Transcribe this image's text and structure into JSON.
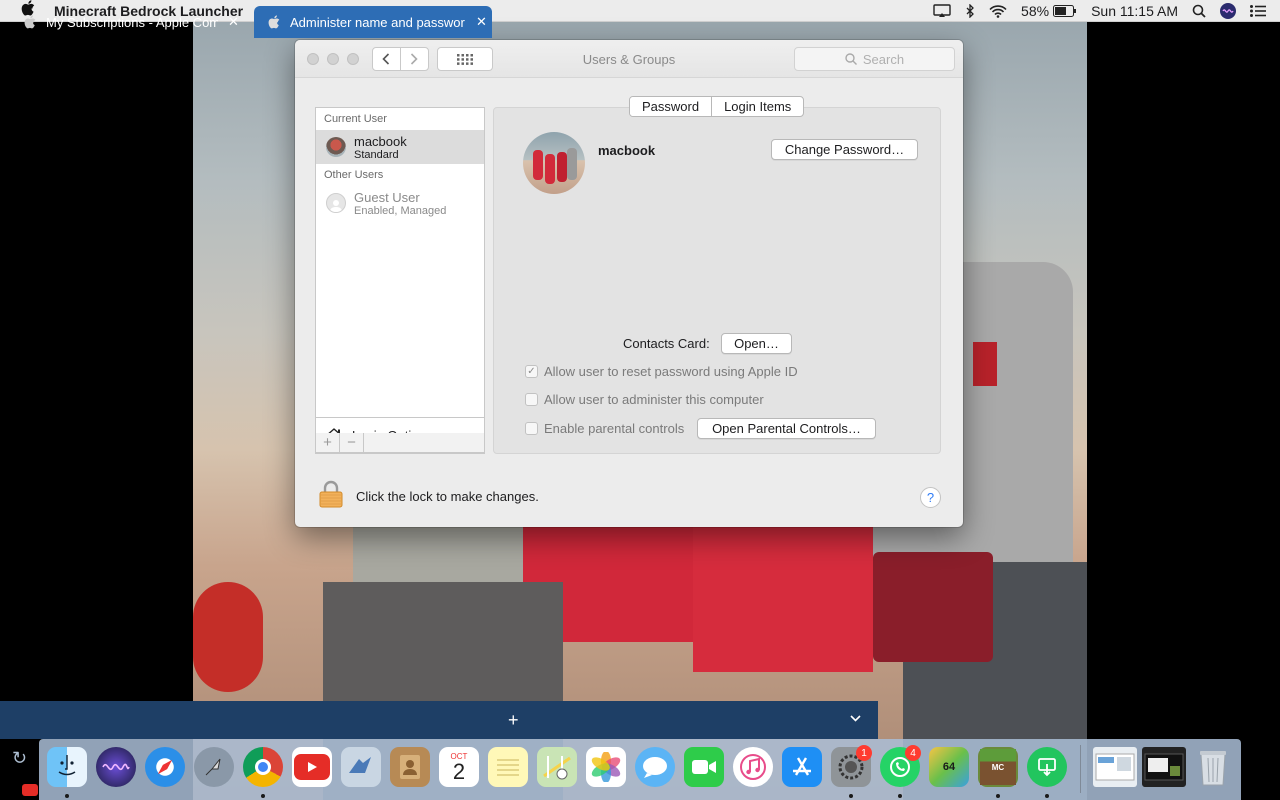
{
  "menubar": {
    "app_name": "Minecraft Bedrock Launcher",
    "battery": "58%",
    "clock": "Sun 11:15 AM"
  },
  "window": {
    "title": "Users & Groups",
    "search_placeholder": "Search"
  },
  "users": {
    "current_user_header": "Current User",
    "current_user": {
      "name": "macbook",
      "role": "Standard"
    },
    "other_users_header": "Other Users",
    "guest": {
      "name": "Guest User",
      "status": "Enabled, Managed"
    },
    "login_options": "Login Options"
  },
  "tabs": {
    "password": "Password",
    "login_items": "Login Items"
  },
  "detail": {
    "username": "macbook",
    "change_password": "Change Password…",
    "contacts_card_label": "Contacts Card:",
    "open": "Open…",
    "allow_reset": "Allow user to reset password using Apple ID",
    "allow_admin": "Allow user to administer this computer",
    "parental": "Enable parental controls",
    "open_parental": "Open Parental Controls…"
  },
  "footer": {
    "lock_text": "Click the lock to make changes.",
    "help": "?"
  },
  "browser": {
    "tab1": "My Subscriptions - Apple Com",
    "tab2": "Administer name and passwor"
  },
  "dock": {
    "calendar_month": "OCT",
    "calendar_day": "2",
    "system_prefs_badge": "1",
    "whatsapp_badge": "4",
    "bluestacks_label": "64"
  },
  "colors": {
    "accent_blue": "#2f7cf6",
    "tab_strip": "#1e3f66",
    "active_tab": "#2d6db5"
  }
}
